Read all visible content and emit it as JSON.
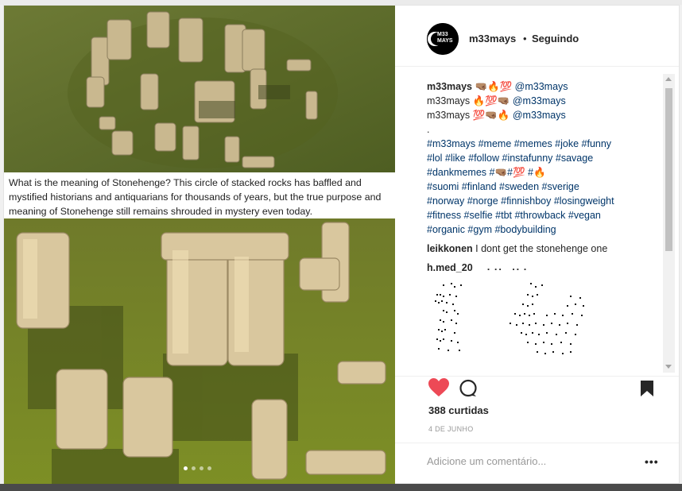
{
  "media": {
    "caption": "What is the meaning of Stonehenge? This circle of stacked rocks has baffled and mystified historians and antiquarians for thousands of years, but the true purpose and meaning of Stonehenge still remains shrouded in mystery even today.",
    "carousel_count": 4,
    "carousel_active": 1
  },
  "header": {
    "avatar_text": "M33 MAYS",
    "username": "m33mays",
    "separator": "•",
    "follow_status": "Seguindo"
  },
  "caption": {
    "lines": [
      {
        "user": "m33mays",
        "emoji": "🤜🏽🔥💯",
        "mention": "@m33mays"
      },
      {
        "user": "m33mays",
        "emoji": "🔥💯🤜🏽",
        "mention": "@m33mays"
      },
      {
        "user": "m33mays",
        "emoji": "💯🤜🏽🔥",
        "mention": "@m33mays"
      }
    ],
    "dot": ".",
    "hashtags": [
      "#m33mays #meme #memes #joke #funny",
      "#lol #like #follow #instafunny #savage",
      "#dankmemes #🤜🏽#💯 #🔥",
      "#suomi #finland #sweden #sverige",
      "#norway #norge #finnishboy #losingweight",
      "#fitness #selfie #tbt #throwback #vegan",
      "#organic #gym #bodybuilding"
    ]
  },
  "comments": [
    {
      "user": "leikkonen",
      "text": "I dont get the stonehenge one"
    },
    {
      "user": "h.med_20",
      "text": "⠠⠠⠄ ⠠⠄⠄"
    }
  ],
  "actions": {
    "likes": "388 curtidas",
    "date": "4 DE JUNHO",
    "add_comment_placeholder": "Adicione um comentário...",
    "more": "•••",
    "heart_color": "#ed4956"
  }
}
